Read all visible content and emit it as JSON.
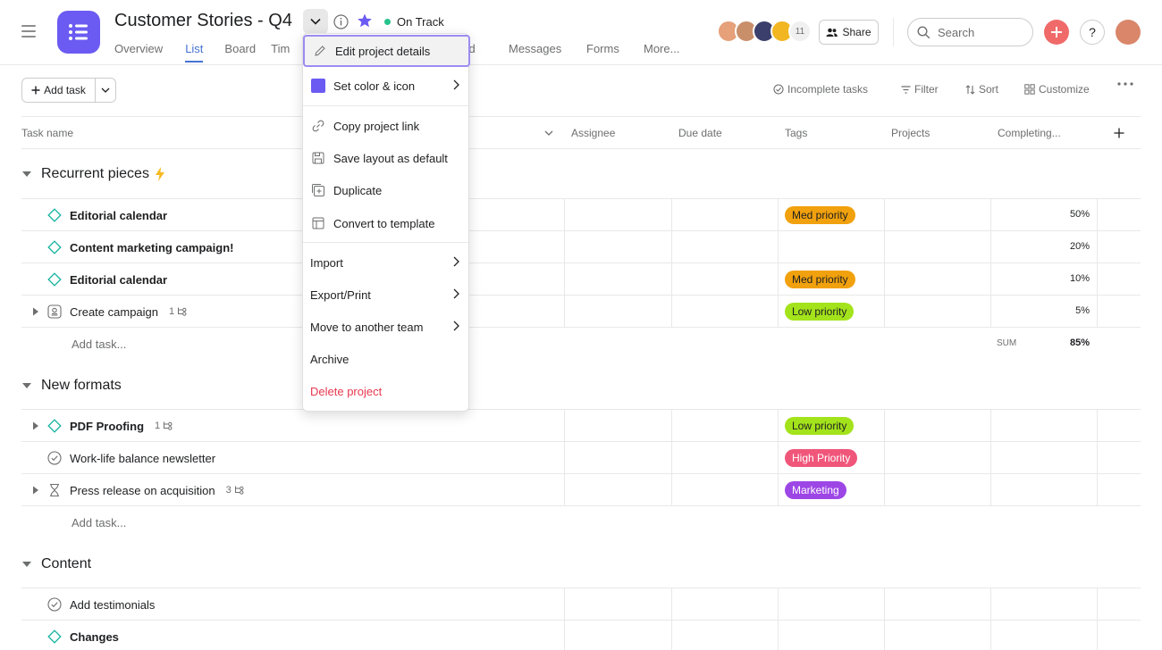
{
  "project": {
    "title": "Customer Stories - Q4",
    "status": "On Track",
    "icon_color": "#6b5bf2",
    "status_color": "#25c38b"
  },
  "tabs": [
    {
      "label": "Overview"
    },
    {
      "label": "List"
    },
    {
      "label": "Board"
    },
    {
      "label": "Tim"
    },
    {
      "label": "ard"
    },
    {
      "label": "Messages"
    },
    {
      "label": "Forms"
    },
    {
      "label": "More..."
    }
  ],
  "header": {
    "member_count": "11",
    "share_label": "Share",
    "search_placeholder": "Search",
    "help_label": "?",
    "plus_color": "#f06a6a"
  },
  "toolbar": {
    "add_task": "Add task",
    "incomplete": "Incomplete tasks",
    "filter": "Filter",
    "sort": "Sort",
    "customize": "Customize"
  },
  "columns": {
    "task_name": "Task name",
    "assignee": "Assignee",
    "due_date": "Due date",
    "tags": "Tags",
    "projects": "Projects",
    "completing": "Completing..."
  },
  "sections": [
    {
      "title": "Recurrent pieces",
      "rows": [
        {
          "name": "Editorial calendar",
          "tag": "Med priority",
          "pct": "50%"
        },
        {
          "name": "Content  marketing campaign!",
          "tag": "",
          "pct": "20%"
        },
        {
          "name": "Editorial calendar",
          "tag": "Med priority",
          "pct": "10%"
        },
        {
          "name": "Create campaign",
          "sub": "1",
          "tag": "Low priority",
          "pct": "5%"
        }
      ],
      "add_task": "Add task...",
      "sum_label": "SUM",
      "sum_value": "85%"
    },
    {
      "title": "New formats",
      "rows": [
        {
          "name": "PDF Proofing",
          "sub": "1",
          "tag": "Low priority"
        },
        {
          "name": "Work-life balance newsletter",
          "tag": "High Priority"
        },
        {
          "name": "Press release on acquisition",
          "sub": "3",
          "tag": "Marketing"
        }
      ],
      "add_task": "Add task..."
    },
    {
      "title": "Content",
      "rows": [
        {
          "name": "Add testimonials"
        },
        {
          "name": "Changes"
        }
      ]
    }
  ],
  "tag_colors": {
    "med": "#f1a10d",
    "low": "#a3e31b",
    "high": "#f0567a",
    "marketing": "#9d46e6"
  },
  "menu": {
    "edit": "Edit project details",
    "color": "Set color & icon",
    "copy_link": "Copy project link",
    "save_layout": "Save layout as default",
    "duplicate": "Duplicate",
    "template": "Convert to template",
    "import": "Import",
    "export": "Export/Print",
    "move": "Move to another team",
    "archive": "Archive",
    "delete": "Delete project",
    "swatch_color": "#6b5bf2"
  }
}
